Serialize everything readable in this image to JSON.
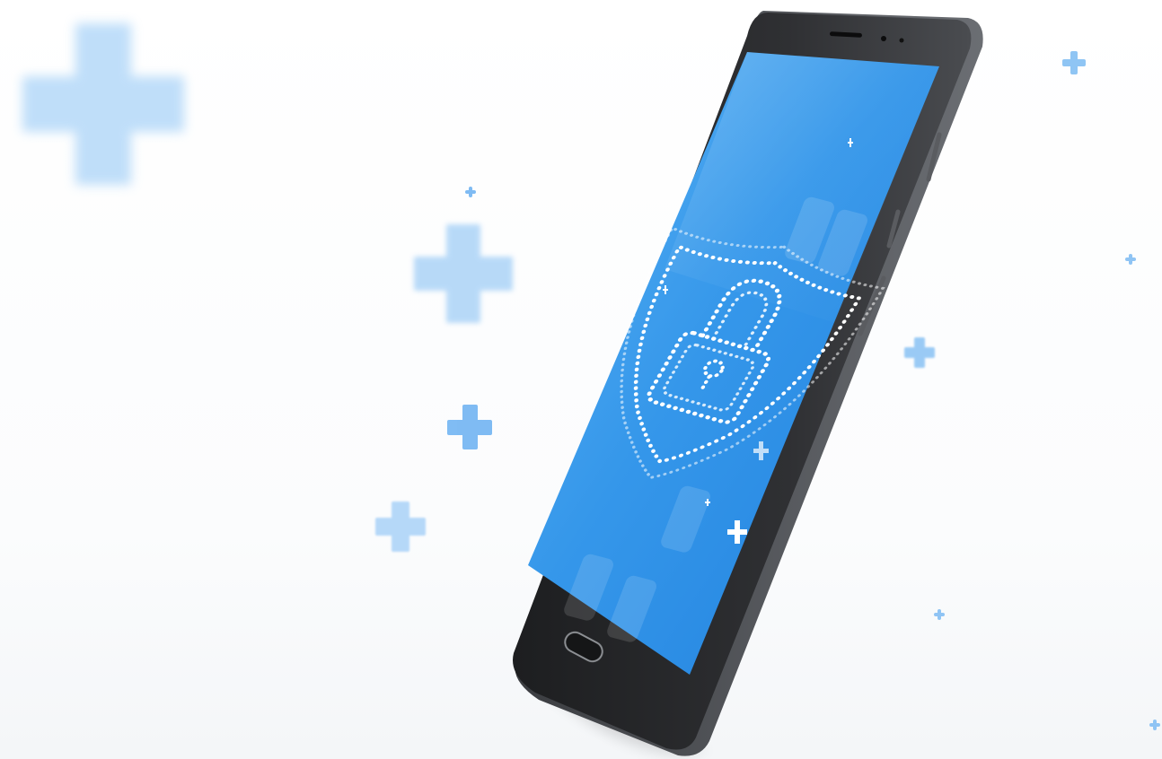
{
  "scene": {
    "subject": "smartphone-with-security-lock-screen",
    "background_color": "#ffffff",
    "accent_color": "#7ab8f2",
    "screen_color": "#2f8ee6",
    "phone_body_color": "#2e2f31",
    "icon": "padlock-shield-icon"
  }
}
